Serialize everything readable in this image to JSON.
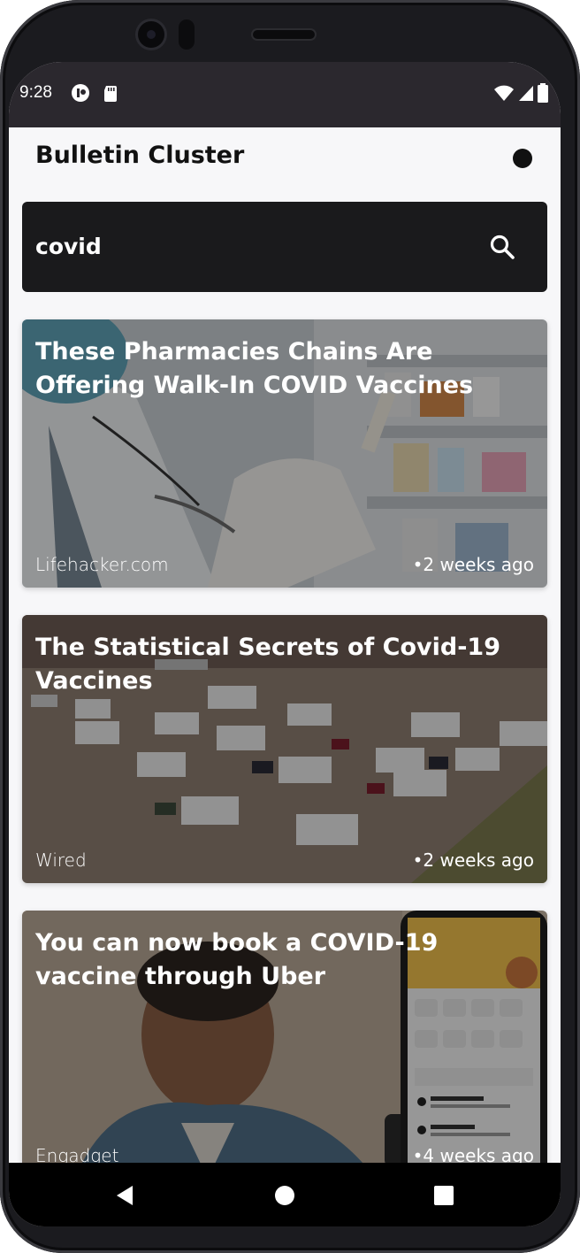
{
  "status_bar": {
    "time": "9:28"
  },
  "app": {
    "title": "Bulletin Cluster"
  },
  "search": {
    "value": "covid"
  },
  "articles": [
    {
      "title": "These Pharmacies Chains Are Offering Walk-In COVID Vaccines",
      "source": "Lifehacker.com",
      "age": "•2 weeks ago"
    },
    {
      "title": "The Statistical Secrets of Covid-19 Vaccines",
      "source": "Wired",
      "age": "•2 weeks ago"
    },
    {
      "title": "You can now book a COVID-19 vaccine through Uber",
      "source": "Engadget",
      "age": "•4 weeks ago"
    }
  ],
  "nav": {
    "back": "back-icon",
    "home": "home-icon",
    "recents": "recents-icon"
  },
  "colors": {
    "status_bar": "#2b282e",
    "search_bg": "#1a1a1c",
    "nav_bg": "#000000",
    "background": "#f7f7f9"
  }
}
